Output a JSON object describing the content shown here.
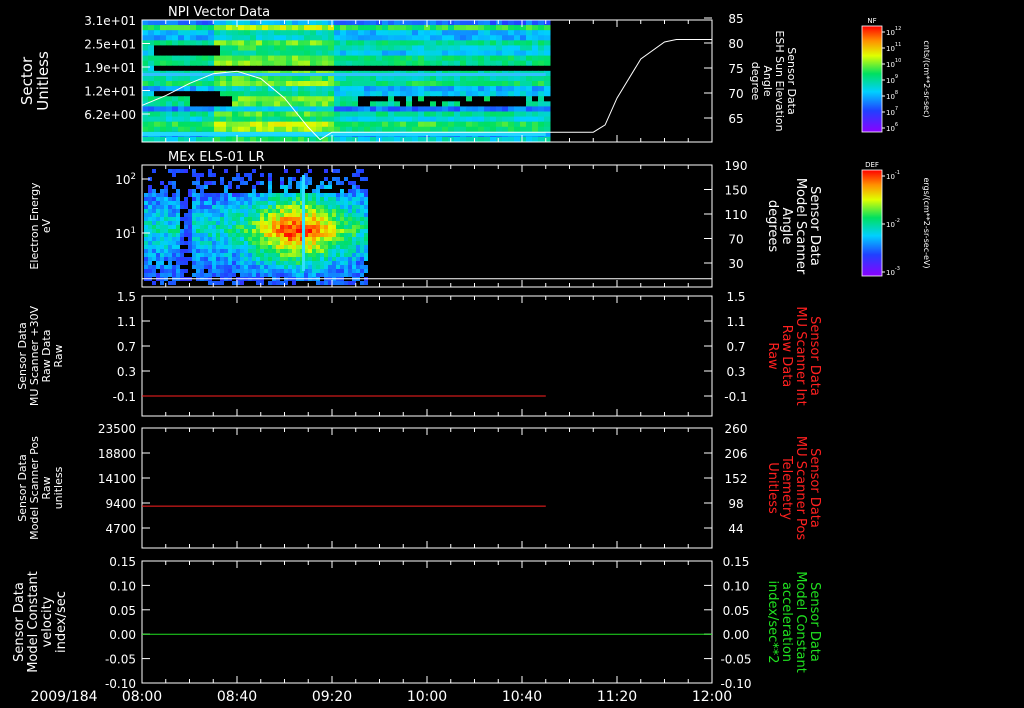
{
  "time_axis": {
    "date_label": "2009/184",
    "ticks": [
      "08:00",
      "08:40",
      "09:20",
      "10:00",
      "10:40",
      "11:20",
      "12:00"
    ]
  },
  "colorbars": [
    {
      "name": "NF",
      "unit": "cnts/(cm**2-sr-sec)",
      "ticks": [
        "10^12",
        "10^11",
        "10^10",
        "10^9",
        "10^8",
        "10^7",
        "10^6"
      ]
    },
    {
      "name": "DEF",
      "unit": "ergs/(cm**2-sr-sec-eV)",
      "ticks": [
        "10^-1",
        "10^-2",
        "10^-3"
      ]
    }
  ],
  "chart_data": [
    {
      "type": "heatmap",
      "title": "NPI Vector Data",
      "ylabel": [
        "Sector",
        "Unitless"
      ],
      "yticks": [
        "3.1e+01",
        "2.5e+01",
        "1.9e+01",
        "1.2e+01",
        "6.2e+00"
      ],
      "ylabel_right": [
        "Sensor Data",
        "ESH Sun Elevation",
        "Angle",
        "degree"
      ],
      "yticks_right": [
        "85",
        "80",
        "75",
        "70",
        "65"
      ],
      "ylim_right": [
        60,
        85
      ],
      "data_extent_time": [
        "08:00",
        "10:50"
      ],
      "line_series": {
        "color": "#ffffff",
        "x": [
          "08:00",
          "08:10",
          "08:20",
          "08:30",
          "08:40",
          "08:50",
          "09:00",
          "09:10",
          "09:15",
          "09:20",
          "09:30",
          "10:00",
          "10:40",
          "11:00",
          "11:10",
          "11:15",
          "11:20",
          "11:30",
          "11:40",
          "11:45",
          "12:00"
        ],
        "y": [
          67.5,
          69.5,
          72,
          74,
          74.5,
          73,
          69,
          63,
          60.5,
          62,
          62,
          62,
          62,
          62,
          62,
          63.5,
          69,
          77,
          80.5,
          81,
          81
        ]
      }
    },
    {
      "type": "heatmap",
      "title": "MEx ELS-01 LR",
      "ylabel": [
        "Electron Energy",
        "eV"
      ],
      "yticks": [
        "10^2",
        "10^1"
      ],
      "ylabel_right": [
        "Sensor Data",
        "Model Scanner",
        "Angle",
        "degrees"
      ],
      "yticks_right": [
        "190",
        "150",
        "110",
        "70",
        "30"
      ],
      "ylim_right": [
        0,
        190
      ],
      "data_extent_time": [
        "08:00",
        "09:35"
      ],
      "line_series": {
        "color": "#ffffff",
        "x": [
          "08:00",
          "12:00"
        ],
        "y": [
          13,
          13
        ]
      }
    },
    {
      "type": "line",
      "ylabel": [
        "Sensor Data",
        "MU Scanner +30V",
        "Raw Data",
        "Raw"
      ],
      "yticks": [
        "1.5",
        "1.1",
        "0.7",
        "0.3",
        "-0.1"
      ],
      "ylim": [
        -0.3,
        1.5
      ],
      "ylabel_right": [
        "Sensor Data",
        "MU Scanner Int",
        "Raw Data",
        "Raw"
      ],
      "yticks_right": [
        "1.5",
        "1.1",
        "0.7",
        "0.3",
        "-0.1"
      ],
      "series": [
        {
          "color": "#ff2020",
          "x": [
            "08:00",
            "10:50"
          ],
          "y": [
            0,
            0
          ]
        }
      ]
    },
    {
      "type": "line",
      "ylabel": [
        "Sensor Data",
        "Model Scanner Pos",
        "Raw",
        "unitless"
      ],
      "yticks": [
        "23500",
        "18800",
        "14100",
        "9400",
        "4700"
      ],
      "ylim": [
        0,
        23500
      ],
      "ylabel_right": [
        "Sensor Data",
        "MU Scanner Pos",
        "Telemetry",
        "Unitless"
      ],
      "yticks_right": [
        "260",
        "206",
        "152",
        "98",
        "44"
      ],
      "series": [
        {
          "color": "#ff2020",
          "x": [
            "08:00",
            "10:50"
          ],
          "y": [
            8200,
            8200
          ]
        }
      ]
    },
    {
      "type": "line",
      "ylabel": [
        "Sensor Data",
        "Model Constant",
        "velocity",
        "index/sec"
      ],
      "yticks": [
        "0.15",
        "0.10",
        "0.05",
        "0.00",
        "-0.05",
        "-0.10"
      ],
      "ylim": [
        -0.1,
        0.15
      ],
      "ylabel_right": [
        "Sensor Data",
        "Model Constant",
        "acceleration",
        "index/sec**2"
      ],
      "yticks_right": [
        "0.15",
        "0.10",
        "0.05",
        "0.00",
        "-0.05",
        "-0.10"
      ],
      "series": [
        {
          "color": "#20e020",
          "x": [
            "08:00",
            "12:00"
          ],
          "y": [
            0,
            0
          ]
        }
      ]
    }
  ]
}
